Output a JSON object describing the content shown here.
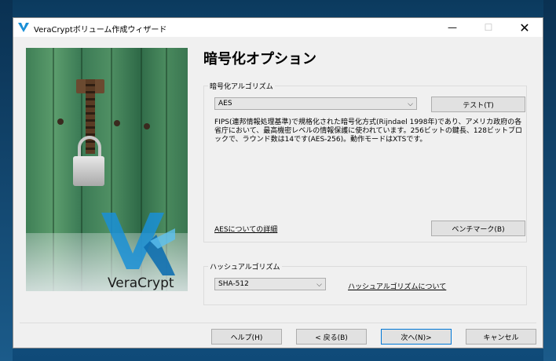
{
  "window": {
    "title": "VeraCryptボリューム作成ウィザード",
    "minimize_glyph": "—",
    "maximize_glyph": "☐",
    "close_glyph": "✕"
  },
  "graphic": {
    "brand": "VeraCrypt",
    "accent_color": "#1a8fd6",
    "logo_icon": "veracrypt-logo-icon",
    "lock_icon": "padlock-icon"
  },
  "page": {
    "title": "暗号化オプション"
  },
  "encryption": {
    "group_label": "暗号化アルゴリズム",
    "algorithm_selected": "AES",
    "test_button": "テスト(T)",
    "description": "FIPS(連邦情報処理基準)で規格化された暗号化方式(Rijndael 1998年)であり、アメリカ政府の各省庁において、最高機密レベルの情報保護に使われています。256ビットの鍵長、128ビットブロックで、ラウンド数は14です(AES-256)。動作モードはXTSです。",
    "details_link": "AESについての詳細",
    "benchmark_button": "ベンチマーク(B)"
  },
  "hash": {
    "group_label": "ハッシュアルゴリズム",
    "algorithm_selected": "SHA-512",
    "about_link": "ハッシュアルゴリズムについて"
  },
  "footer": {
    "help_button": "ヘルプ(H)",
    "back_button": "< 戻る(B)",
    "next_button": "次へ(N)>",
    "cancel_button": "キャンセル"
  }
}
